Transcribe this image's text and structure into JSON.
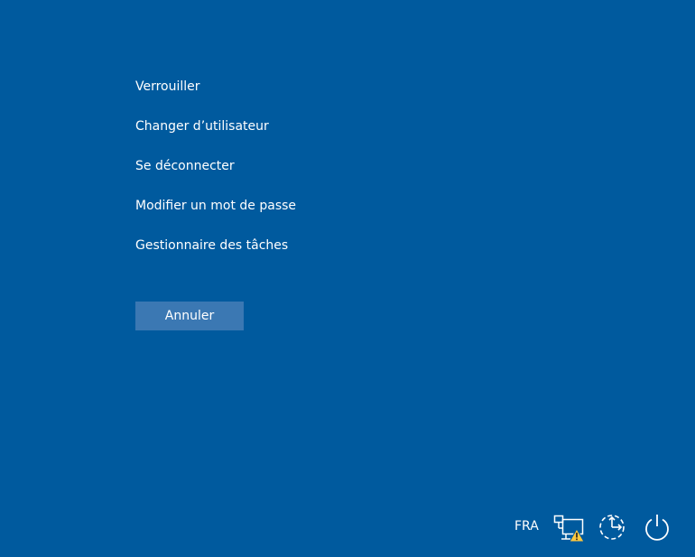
{
  "menu": {
    "items": [
      {
        "label": "Verrouiller"
      },
      {
        "label": "Changer d’utilisateur"
      },
      {
        "label": "Se déconnecter"
      },
      {
        "label": "Modifier un mot de passe"
      },
      {
        "label": "Gestionnaire des tâches"
      }
    ]
  },
  "cancel_label": "Annuler",
  "tray": {
    "language": "FRA",
    "icons": [
      "network-warning-icon",
      "ease-of-access-icon",
      "power-icon"
    ]
  },
  "colors": {
    "background": "#005a9e",
    "button": "#3b78b3",
    "text": "#ffffff",
    "warning": "#ffc83d"
  }
}
